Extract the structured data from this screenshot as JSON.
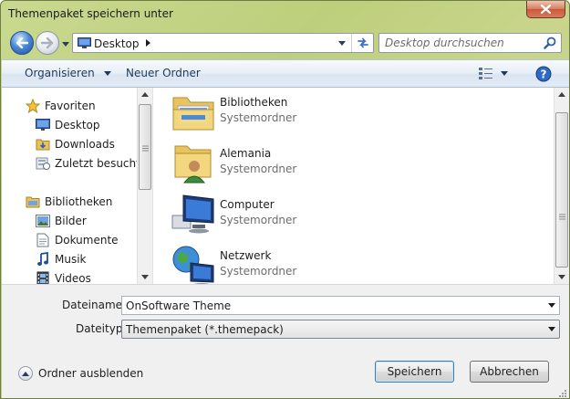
{
  "window": {
    "title": "Themenpaket speichern unter"
  },
  "address": {
    "location": "Desktop"
  },
  "search": {
    "placeholder": "Desktop durchsuchen"
  },
  "toolbar": {
    "organize_label": "Organisieren",
    "new_folder_label": "Neuer Ordner"
  },
  "nav": {
    "favorites_label": "Favoriten",
    "favorites": [
      {
        "label": "Desktop",
        "icon": "desktop-icon"
      },
      {
        "label": "Downloads",
        "icon": "downloads-folder-icon"
      },
      {
        "label": "Zuletzt besucht",
        "icon": "recent-places-icon"
      }
    ],
    "libraries_label": "Bibliotheken",
    "libraries": [
      {
        "label": "Bilder",
        "icon": "pictures-icon"
      },
      {
        "label": "Dokumente",
        "icon": "documents-icon"
      },
      {
        "label": "Musik",
        "icon": "music-icon"
      },
      {
        "label": "Videos",
        "icon": "videos-icon"
      }
    ]
  },
  "files": [
    {
      "name": "Bibliotheken",
      "type": "Systemordner",
      "icon": "libraries-folder-icon"
    },
    {
      "name": "Alemania",
      "type": "Systemordner",
      "icon": "user-folder-icon"
    },
    {
      "name": "Computer",
      "type": "Systemordner",
      "icon": "computer-icon"
    },
    {
      "name": "Netzwerk",
      "type": "Systemordner",
      "icon": "network-icon"
    }
  ],
  "form": {
    "filename_label": "Dateiname:",
    "filename_value": "OnSoftware Theme",
    "filetype_label": "Dateityp:",
    "filetype_value": "Themenpaket (*.themepack)"
  },
  "footer": {
    "hide_folders_label": "Ordner ausblenden",
    "save_label": "Speichern",
    "cancel_label": "Abbrechen"
  },
  "colors": {
    "toolbar_text": "#1e395b",
    "secondary_text": "#6d6d6d",
    "frame_tint": "#bdcf7c"
  }
}
